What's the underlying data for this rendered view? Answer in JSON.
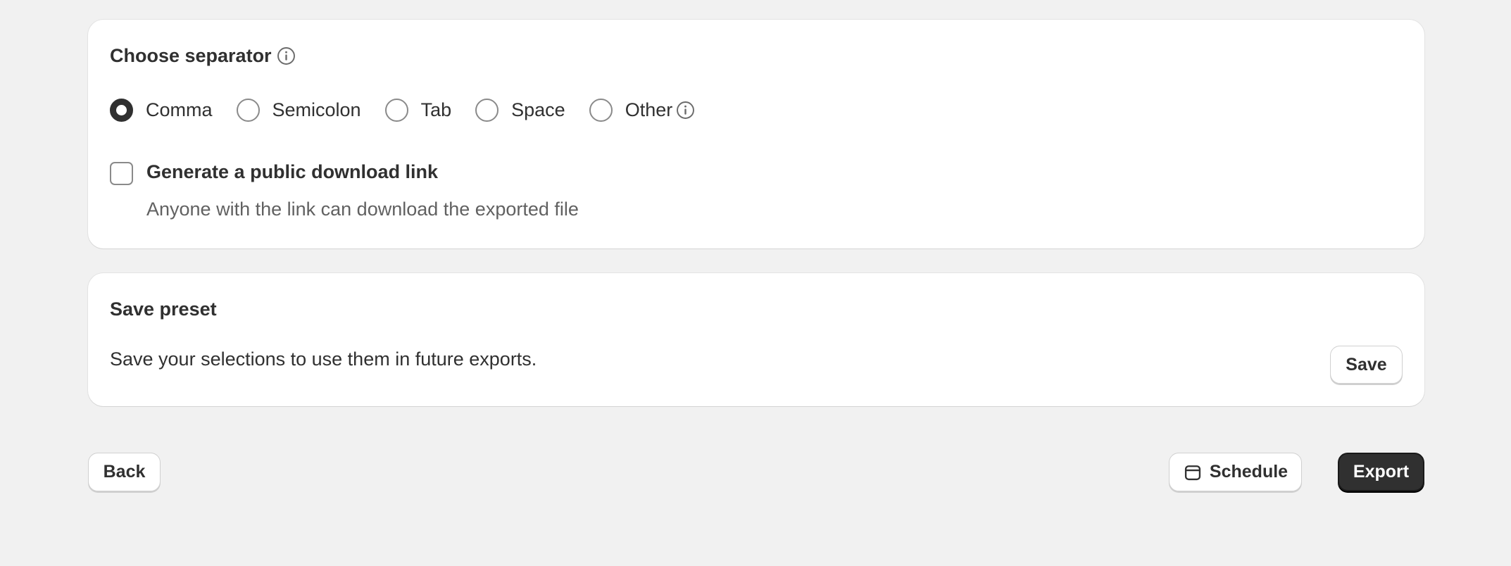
{
  "separator_card": {
    "title": "Choose separator",
    "options": [
      {
        "label": "Comma",
        "selected": true
      },
      {
        "label": "Semicolon",
        "selected": false
      },
      {
        "label": "Tab",
        "selected": false
      },
      {
        "label": "Space",
        "selected": false
      },
      {
        "label": "Other",
        "selected": false
      }
    ],
    "public_link": {
      "label": "Generate a public download link",
      "help": "Anyone with the link can download the exported file",
      "checked": false
    }
  },
  "preset_card": {
    "title": "Save preset",
    "description": "Save your selections to use them in future exports.",
    "save_label": "Save"
  },
  "footer": {
    "back_label": "Back",
    "schedule_label": "Schedule",
    "export_label": "Export"
  },
  "icons": {
    "info": "info-icon",
    "schedule": "calendar-icon"
  },
  "colors": {
    "background": "#f1f1f1",
    "card": "#ffffff",
    "primary_button": "#303030",
    "text": "#303030",
    "muted_text": "#616161"
  }
}
